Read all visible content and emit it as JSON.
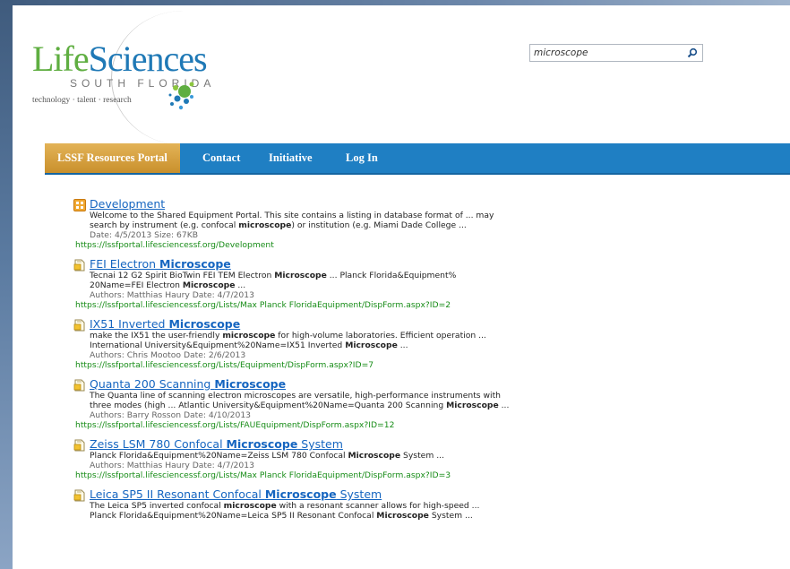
{
  "logo": {
    "life": "Life",
    "sciences": "Sciences",
    "region": "SOUTH FLORIDA",
    "tagline": "technology · talent · research"
  },
  "search": {
    "value": "microscope",
    "icon": "search-icon"
  },
  "nav": {
    "items": [
      {
        "label": "LSSF Resources Portal",
        "active": true
      },
      {
        "label": "Contact",
        "active": false
      },
      {
        "label": "Initiative",
        "active": false
      },
      {
        "label": "Log In",
        "active": false
      }
    ]
  },
  "colors": {
    "nav_bg": "#1f7fc3",
    "nav_active": "#d39e3a",
    "link": "#1565c0",
    "url_green": "#178c17",
    "logo_green": "#5fae41",
    "logo_blue": "#1f79b6"
  },
  "results": [
    {
      "icon": "site-icon",
      "title": "Development",
      "desc": [
        "Welcome to the Shared Equipment Portal.  This site contains a listing in database format of ... may",
        "search by instrument (e.g. confocal [[microscope]]) or institution (e.g. Miami Dade College ..."
      ],
      "meta": "Date: 4/5/2013   Size: 67KB",
      "url": "https://lssfportal.lifesciencessf.org/Development"
    },
    {
      "icon": "list-item-icon",
      "title": "FEI Electron [[Microscope]]",
      "desc": [
        "Tecnai 12 G2 Spirit BioTwin FEI TEM Electron [[Microscope]] ... Planck Florida&Equipment%",
        "20Name=FEI Electron [[Microscope]] ..."
      ],
      "meta": "Authors: Matthias Haury   Date: 4/7/2013",
      "url": "https://lssfportal.lifesciencessf.org/Lists/Max Planck FloridaEquipment/DispForm.aspx?ID=2"
    },
    {
      "icon": "list-item-icon",
      "title": "IX51 Inverted [[Microscope]]",
      "desc": [
        "make the IX51 the user-friendly [[microscope]] for high-volume laboratories. Efficient operation ...",
        "International University&Equipment%20Name=IX51 Inverted [[Microscope]] ..."
      ],
      "meta": "Authors: Chris Mootoo   Date: 2/6/2013",
      "url": "https://lssfportal.lifesciencessf.org/Lists/Equipment/DispForm.aspx?ID=7"
    },
    {
      "icon": "list-item-icon",
      "title": "Quanta 200 Scanning [[Microscope]]",
      "desc": [
        "The Quanta line of scanning electron microscopes are versatile, high-performance instruments with",
        "three modes (high ... Atlantic University&Equipment%20Name=Quanta 200 Scanning [[Microscope]] ..."
      ],
      "meta": "Authors: Barry Rosson   Date: 4/10/2013",
      "url": "https://lssfportal.lifesciencessf.org/Lists/FAUEquipment/DispForm.aspx?ID=12"
    },
    {
      "icon": "list-item-icon",
      "title": "Zeiss LSM 780 Confocal [[Microscope]] System",
      "desc": [
        "Planck Florida&Equipment%20Name=Zeiss LSM 780 Confocal [[Microscope]] System ..."
      ],
      "meta": "Authors: Matthias Haury   Date: 4/7/2013",
      "url": "https://lssfportal.lifesciencessf.org/Lists/Max Planck FloridaEquipment/DispForm.aspx?ID=3"
    },
    {
      "icon": "list-item-icon",
      "title": "Leica SP5 II Resonant Confocal [[Microscope]] System",
      "desc": [
        "The Leica SP5 inverted confocal [[microscope]] with a resonant scanner allows for high-speed ...",
        "Planck Florida&Equipment%20Name=Leica SP5 II Resonant Confocal [[Microscope]] System ..."
      ],
      "meta": "",
      "url": ""
    }
  ]
}
